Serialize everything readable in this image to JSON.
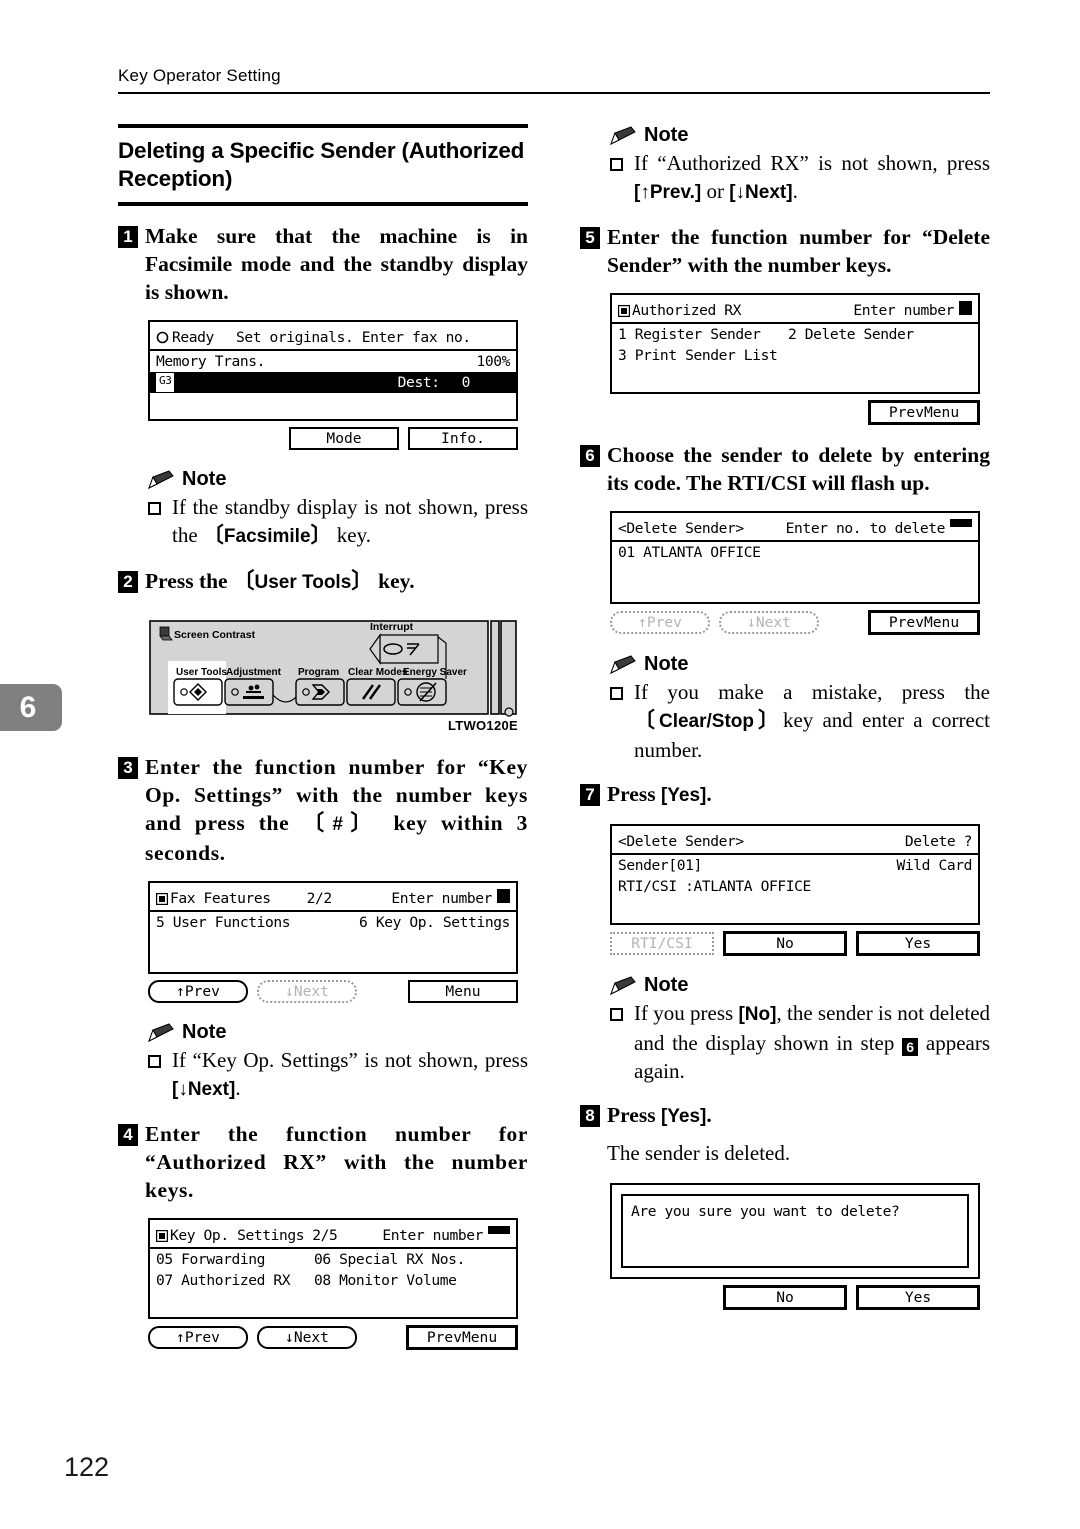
{
  "page": {
    "running_head": "Key Operator Setting",
    "chapter_tab": "6",
    "page_number": "122"
  },
  "section": {
    "title": "Deleting a Specific Sender (Authorized Reception)"
  },
  "labels": {
    "note": "Note"
  },
  "steps": {
    "s1": {
      "num": "1",
      "text": "Make sure that the machine is in Facsimile mode and the standby display is shown."
    },
    "s2": {
      "num": "2",
      "prefix": "Press the",
      "key": "User Tools",
      "suffix": "key."
    },
    "s3": {
      "num": "3",
      "part1": "Enter the function number for “Key Op. Settings” with the number keys and press the",
      "key": "#",
      "part2": "key within 3 seconds."
    },
    "s4": {
      "num": "4",
      "text": "Enter the function number for “Authorized RX” with the number keys."
    },
    "s5": {
      "num": "5",
      "text": "Enter the function number for “Delete Sender” with the number keys."
    },
    "s6": {
      "num": "6",
      "text": "Choose the sender to delete by entering its code. The RTI/CSI will flash up."
    },
    "s7": {
      "num": "7",
      "prefix": "Press",
      "key": "Yes",
      "suffix": "."
    },
    "s8": {
      "num": "8",
      "prefix": "Press",
      "key": "Yes",
      "suffix": ".",
      "body": "The sender is deleted."
    }
  },
  "notes": {
    "n1": {
      "part1": "If the standby display is not shown, press the",
      "key": "Facsimile",
      "part2": "key."
    },
    "n2": {
      "part1": "If “Key Op. Settings” is not shown, press",
      "key": "[↓Next]",
      "part2": "."
    },
    "n3": {
      "part1": "If “Authorized RX” is not shown, press",
      "key1": "[↑Prev.]",
      "mid": "or",
      "key2": "[↓Next]",
      "part2": "."
    },
    "n4": {
      "part1": "If you make a mistake, press the",
      "key": "Clear/Stop",
      "part2": "key and enter a correct number."
    },
    "n5": {
      "part1": "If you press",
      "key": "[No]",
      "part2": ", the sender is not deleted and the display shown in step",
      "step_ref": "6",
      "part3": "appears again."
    }
  },
  "lcd1": {
    "status": "Ready",
    "prompt": "Set originals. Enter fax no.",
    "mode": "Memory Trans.",
    "percent": "100%",
    "line_badge": "G3",
    "dest_label": "Dest:",
    "dest_value": "0",
    "buttons": [
      "Mode",
      "Info."
    ]
  },
  "lcd2": {
    "title": "Fax Features",
    "page": "2/2",
    "hint": "Enter number",
    "items": [
      "5 User Functions",
      "6 Key Op. Settings"
    ],
    "buttons": {
      "prev": "↑Prev",
      "next": "↓Next",
      "menu": "Menu"
    }
  },
  "lcd3": {
    "title": "Key Op. Settings",
    "page": "2/5",
    "hint": "Enter number",
    "items": [
      [
        "05 Forwarding",
        "06 Special RX Nos."
      ],
      [
        "07 Authorized RX",
        "08 Monitor Volume"
      ]
    ],
    "buttons": {
      "prev": "↑Prev",
      "next": "↓Next",
      "prevmenu": "PrevMenu"
    }
  },
  "lcd4": {
    "title": "Authorized RX",
    "hint": "Enter number",
    "items": [
      [
        "1 Register Sender",
        "2 Delete Sender"
      ],
      [
        "3 Print Sender List",
        ""
      ]
    ],
    "buttons": {
      "prevmenu": "PrevMenu"
    }
  },
  "lcd5": {
    "title": "<Delete Sender>",
    "hint": "Enter no. to delete",
    "items": [
      "01 ATLANTA OFFICE"
    ],
    "buttons": {
      "prev": "↑Prev",
      "next": "↓Next",
      "prevmenu": "PrevMenu"
    }
  },
  "lcd6": {
    "title": "<Delete Sender>",
    "hint": "Delete ?",
    "row1_left": "Sender[01]",
    "row1_right": "Wild Card",
    "row2": "RTI/CSI :ATLANTA OFFICE",
    "buttons": {
      "rticsi": "RTI/CSI",
      "no": "No",
      "yes": "Yes"
    }
  },
  "lcd7": {
    "message": "Are you sure you want to delete?",
    "buttons": {
      "no": "No",
      "yes": "Yes"
    }
  },
  "panel": {
    "screen_contrast": "Screen Contrast",
    "interrupt": "Interrupt",
    "keys": [
      "User Tools",
      "Adjustment",
      "Program",
      "Clear Modes",
      "Energy Saver"
    ],
    "figure_code": "LTWO120E"
  }
}
